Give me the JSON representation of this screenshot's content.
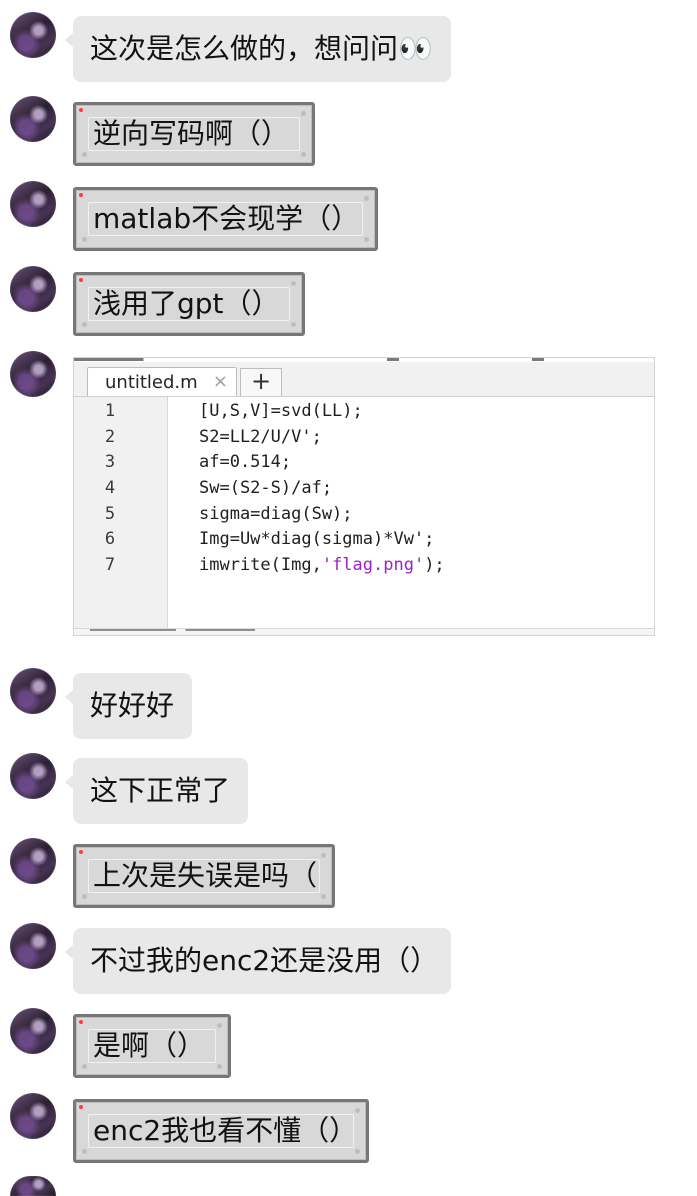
{
  "messages": [
    {
      "text": "这次是怎么做的，想问问👀"
    },
    {
      "text": "逆向写码啊（）"
    },
    {
      "text": "matlab不会现学（）"
    },
    {
      "text": "浅用了gpt（）"
    },
    {
      "code_snippet": {
        "tab_label": "untitled.m",
        "close_glyph": "×",
        "new_tab_glyph": "+",
        "lines": [
          {
            "number": "1",
            "before": "[U,S,V]=svd(LL);",
            "string": "",
            "after": ""
          },
          {
            "number": "2",
            "before": "S2=LL2/U/V';",
            "string": "",
            "after": ""
          },
          {
            "number": "3",
            "before": "af=0.514;",
            "string": "",
            "after": ""
          },
          {
            "number": "4",
            "before": "Sw=(S2-S)/af;",
            "string": "",
            "after": ""
          },
          {
            "number": "5",
            "before": "sigma=diag(Sw);",
            "string": "",
            "after": ""
          },
          {
            "number": "6",
            "before": "Img=Uw*diag(sigma)*Vw';",
            "string": "",
            "after": ""
          },
          {
            "number": "7",
            "before": "imwrite(Img,",
            "string": "'flag.png'",
            "after": ");"
          }
        ]
      }
    },
    {
      "text": "好好好"
    },
    {
      "text": "这下正常了"
    },
    {
      "text": "上次是失误是吗（"
    },
    {
      "text": "不过我的enc2还是没用（）"
    },
    {
      "text": "是啊（）"
    },
    {
      "text": "enc2我也看不懂（）"
    }
  ],
  "colors": {
    "plain_bubble": "#e8e8e8",
    "framed_bubble": "#d8d8d8",
    "frame_border": "#777777",
    "text": "#121212",
    "code_string": "#9b22c7",
    "gutter": "#f1f1f1"
  }
}
